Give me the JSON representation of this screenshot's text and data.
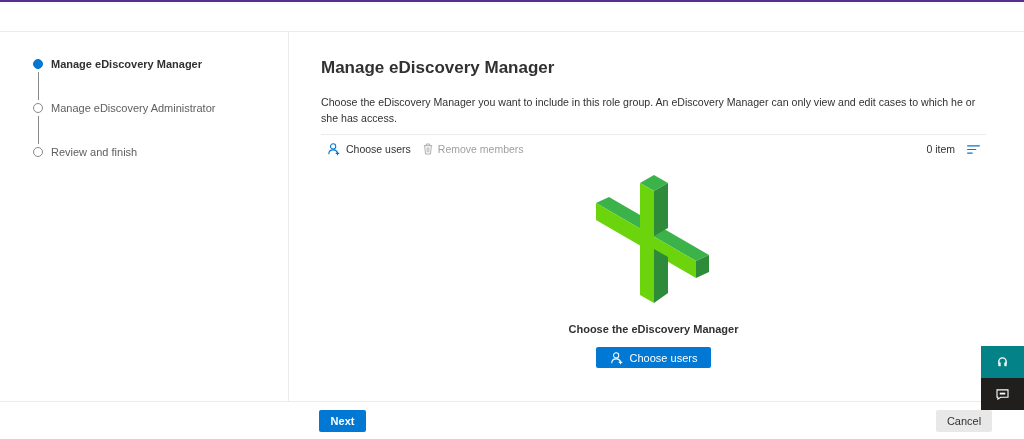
{
  "steps": [
    {
      "label": "Manage eDiscovery Manager",
      "selected": true
    },
    {
      "label": "Manage eDiscovery Administrator",
      "selected": false
    },
    {
      "label": "Review and finish",
      "selected": false
    }
  ],
  "title": "Manage eDiscovery Manager",
  "description": "Choose the eDiscovery Manager you want to include in this role group. An eDiscovery Manager can only view and edit cases to which he or she has access.",
  "toolbar": {
    "choose_users": "Choose users",
    "remove_members": {
      "label": "Remove members",
      "disabled": true
    },
    "count": "0 item"
  },
  "empty_state": {
    "heading": "Choose the eDiscovery Manager",
    "button": "Choose users"
  },
  "footer": {
    "next": "Next",
    "cancel": "Cancel"
  }
}
